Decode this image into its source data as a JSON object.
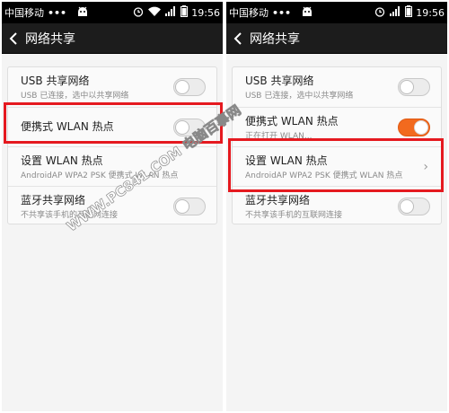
{
  "status_bar": {
    "carrier": "中国移动",
    "dots": "•••",
    "time": "19:56"
  },
  "title_bar": {
    "title": "网络共享"
  },
  "screens": [
    {
      "rows": [
        {
          "label": "USB 共享网络",
          "sub": "USB 已连接，选中以共享网络",
          "toggle_on": false
        },
        {
          "label": "便携式 WLAN 热点",
          "sub": "",
          "toggle_on": false
        },
        {
          "label": "设置 WLAN 热点",
          "sub": "AndroidAP WPA2 PSK 便携式 WLAN 热点"
        },
        {
          "label": "蓝牙共享网络",
          "sub": "不共享该手机的互联网连接",
          "toggle_on": false
        }
      ]
    },
    {
      "rows": [
        {
          "label": "USB 共享网络",
          "sub": "USB 已连接，选中以共享网络",
          "toggle_on": false
        },
        {
          "label": "便携式 WLAN 热点",
          "sub": "正在打开 WLAN...",
          "toggle_on": true
        },
        {
          "label": "设置 WLAN 热点",
          "sub": "AndroidAP WPA2 PSK 便携式 WLAN 热点",
          "chevron": "›"
        },
        {
          "label": "蓝牙共享网络",
          "sub": "不共享该手机的互联网连接",
          "toggle_on": false
        }
      ]
    }
  ],
  "watermark": "WWW.PC841.COM 电脑百事网",
  "colors": {
    "highlight": "#e5191f",
    "toggle_on": "#f26a1e",
    "title_bar": "#1c1c1c"
  }
}
